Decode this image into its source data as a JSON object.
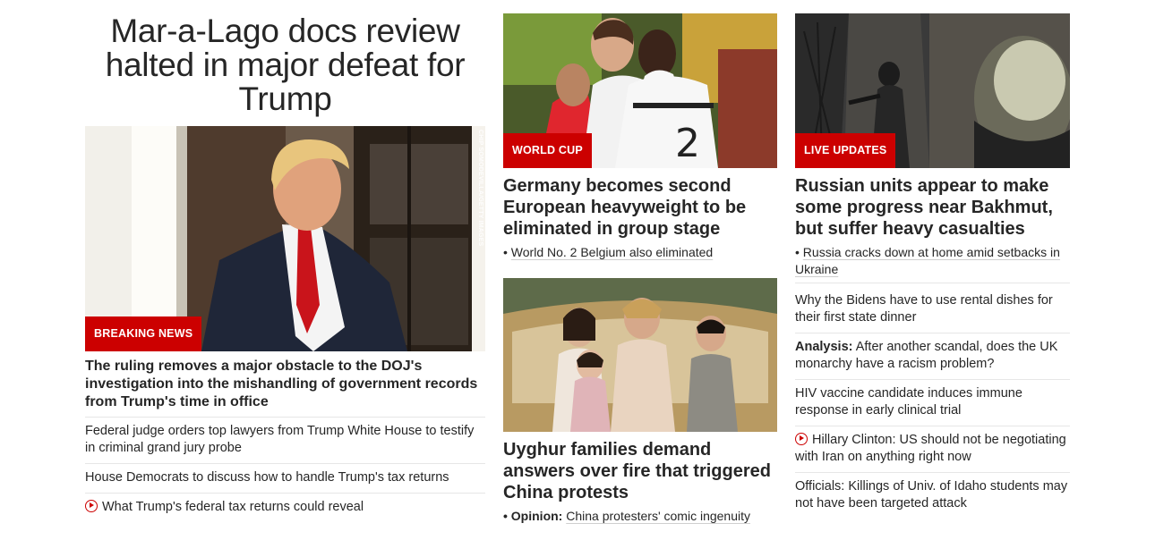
{
  "lead": {
    "headline": "Mar-a-Lago docs review halted in major defeat for Trump",
    "badge": "BREAKING NEWS",
    "photo_credit": "CHIP SOMODEVILLA/GETTY IMAGES",
    "subheadline": "The ruling removes a major obstacle to the DOJ's investigation into the mishandling of government records from Trump's time in office",
    "related": [
      {
        "text": "Federal judge orders top lawyers from Trump White House to testify in criminal grand jury probe"
      },
      {
        "text": "House Democrats to discuss how to handle Trump's tax returns"
      },
      {
        "text": "What Trump's federal tax returns could reveal"
      }
    ]
  },
  "middle": {
    "card1": {
      "badge": "WORLD CUP",
      "headline": "Germany becomes second European heavyweight to be eliminated in group stage",
      "bullet": "•",
      "link": "World No. 2 Belgium also eliminated"
    },
    "card2": {
      "headline": "Uyghur families demand answers over fire that triggered China protests",
      "bullet": "•",
      "link_label": "Opinion:",
      "link": "China protesters' comic ingenuity"
    }
  },
  "right": {
    "card": {
      "badge": "LIVE UPDATES",
      "headline": "Russian units appear to make some progress near Bakhmut, but suffer heavy casualties",
      "bullet": "•",
      "link": "Russia cracks down at home amid setbacks in Ukraine"
    },
    "list": [
      {
        "text": "Why the Bidens have to use rental dishes for their first state dinner"
      },
      {
        "label": "Analysis:",
        "text": "After another scandal, does the UK monarchy have a racism problem?"
      },
      {
        "text": "HIV vaccine candidate induces immune response in early clinical trial"
      },
      {
        "text": "Hillary Clinton: US should not be negotiating with Iran on anything right now"
      },
      {
        "text": "Officials: Killings of Univ. of Idaho students may not have been targeted attack"
      }
    ]
  },
  "colors": {
    "accent": "#cc0000",
    "text": "#262626",
    "divider": "#e6e6e6"
  },
  "icons": {
    "video": "play-icon"
  }
}
